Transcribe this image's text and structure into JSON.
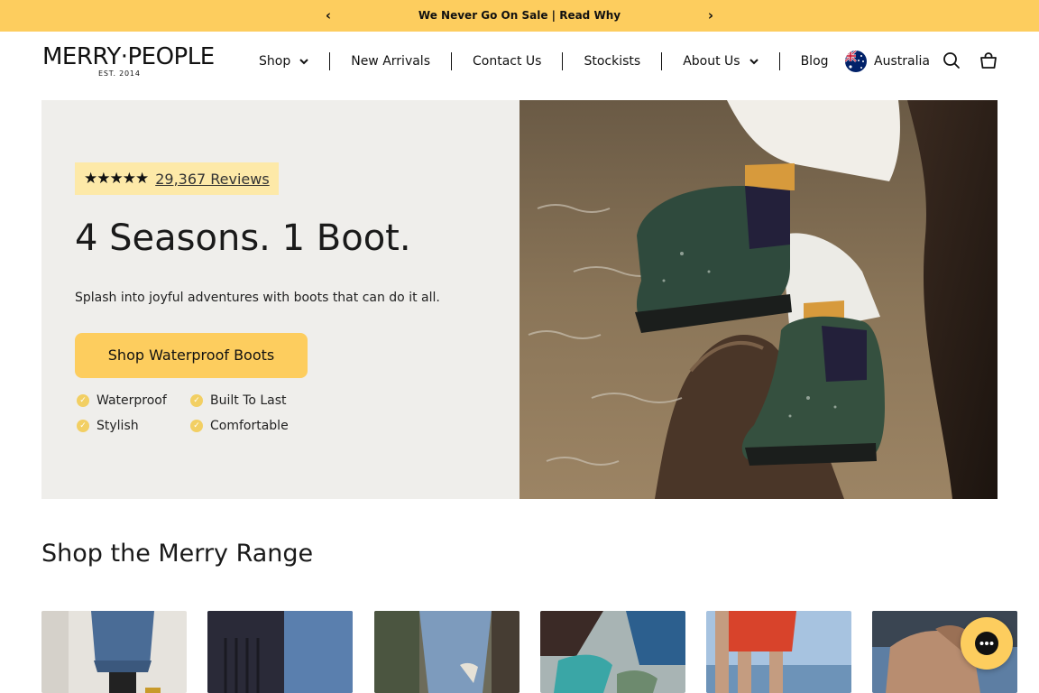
{
  "announcement": {
    "message": "We Never Go On Sale | Read Why",
    "prev_symbol": "‹",
    "next_symbol": "›"
  },
  "brand": {
    "wordmark": "MERRY·PEOPLE",
    "established": "EST. 2014"
  },
  "nav": {
    "items": [
      {
        "label": "Shop",
        "has_dropdown": true
      },
      {
        "label": "New Arrivals",
        "has_dropdown": false
      },
      {
        "label": "Contact Us",
        "has_dropdown": false
      },
      {
        "label": "Stockists",
        "has_dropdown": false
      },
      {
        "label": "About Us",
        "has_dropdown": true
      },
      {
        "label": "Blog",
        "has_dropdown": false
      }
    ]
  },
  "header": {
    "locale_label": "Australia",
    "icons": [
      "australia-flag-icon",
      "search-icon",
      "cart-icon"
    ]
  },
  "hero": {
    "stars": "★★★★★",
    "reviews_label": "29,367 Reviews",
    "title": "4 Seasons. 1 Boot.",
    "subtitle": "Splash into joyful adventures with boots that can do it all.",
    "cta_label": "Shop Waterproof Boots",
    "features": [
      "Waterproof",
      "Built To Last",
      "Stylish",
      "Comfortable"
    ]
  },
  "range": {
    "title": "Shop the Merry Range"
  },
  "colors": {
    "accent": "#fdcd5e",
    "rating_bg": "#fde9a8",
    "hero_bg": "#efeeeb",
    "check": "#f2cf63"
  }
}
